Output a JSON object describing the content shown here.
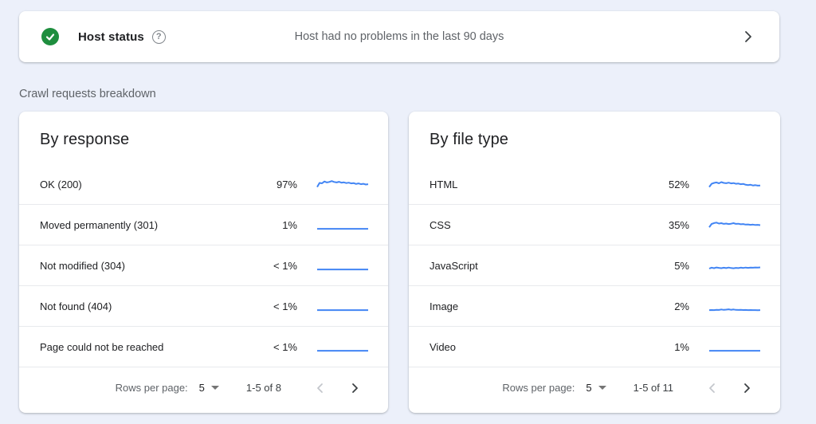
{
  "host_status": {
    "label": "Host status",
    "message": "Host had no problems in the last 90 days"
  },
  "section_title": "Crawl requests breakdown",
  "cards": [
    {
      "title": "By response",
      "rows": [
        {
          "label": "OK (200)",
          "percent": "97%",
          "spark": [
            2.5,
            7,
            6.5,
            8.5,
            7.5,
            8,
            9,
            8,
            7.5,
            8.2,
            7.2,
            7.6,
            6.8,
            7.2,
            6.4,
            6.8,
            5.8,
            6.4,
            5.6,
            6,
            5.2,
            5.6
          ]
        },
        {
          "label": "Moved permanently (301)",
          "percent": "1%",
          "spark": [
            1.2,
            1.2,
            1.2,
            1.2,
            1.2,
            1.2,
            1.2,
            1.2,
            1.2,
            1.2,
            1.2,
            1.2,
            1.2,
            1.2,
            1.2,
            1.2,
            1.2,
            1.2,
            1.2,
            1.2,
            1.2,
            1.2
          ]
        },
        {
          "label": "Not modified (304)",
          "percent": "< 1%",
          "spark": [
            1.2,
            1.2,
            1.2,
            1.2,
            1.2,
            1.2,
            1.2,
            1.2,
            1.2,
            1.2,
            1.2,
            1.2,
            1.2,
            1.2,
            1.2,
            1.2,
            1.2,
            1.2,
            1.2,
            1.2,
            1.2,
            1.2
          ]
        },
        {
          "label": "Not found (404)",
          "percent": "< 1%",
          "spark": [
            1.2,
            1.2,
            1.2,
            1.2,
            1.2,
            1.2,
            1.2,
            1.2,
            1.2,
            1.2,
            1.2,
            1.2,
            1.2,
            1.2,
            1.2,
            1.2,
            1.2,
            1.2,
            1.2,
            1.2,
            1.2,
            1.2
          ]
        },
        {
          "label": "Page could not be reached",
          "percent": "< 1%",
          "spark": [
            1.2,
            1.2,
            1.2,
            1.2,
            1.2,
            1.2,
            1.2,
            1.2,
            1.2,
            1.2,
            1.2,
            1.2,
            1.2,
            1.2,
            1.2,
            1.2,
            1.2,
            1.2,
            1.2,
            1.2,
            1.2,
            1.2
          ]
        }
      ],
      "footer": {
        "rows_per_page_label": "Rows per page:",
        "rows_per_page_value": "5",
        "range": "1-5 of 8"
      }
    },
    {
      "title": "By file type",
      "rows": [
        {
          "label": "HTML",
          "percent": "52%",
          "spark": [
            2.5,
            6,
            7,
            7.5,
            6.5,
            7.8,
            7,
            6.6,
            7.2,
            6.4,
            6.8,
            6,
            6.3,
            5.6,
            5.9,
            5,
            4.6,
            5,
            4.2,
            4.5,
            4,
            4.2
          ]
        },
        {
          "label": "CSS",
          "percent": "35%",
          "spark": [
            3,
            6.5,
            7.5,
            8,
            7,
            7.4,
            6.6,
            7,
            6.4,
            6.8,
            7.4,
            6.6,
            6.8,
            6.2,
            6.4,
            5.8,
            6,
            5.6,
            5.8,
            5.4,
            5.6,
            5.2
          ]
        },
        {
          "label": "JavaScript",
          "percent": "5%",
          "spark": [
            2.2,
            3.2,
            2.6,
            3.4,
            3,
            2.6,
            3.1,
            2.7,
            3.3,
            2.8,
            2.5,
            3,
            2.7,
            3.2,
            2.9,
            3.3,
            3,
            3.3,
            3.1,
            3.4,
            3.2,
            3.5
          ]
        },
        {
          "label": "Image",
          "percent": "2%",
          "spark": [
            1.2,
            1.3,
            1.2,
            1.6,
            1.4,
            1.9,
            1.5,
            1.7,
            2.1,
            1.6,
            1.9,
            1.5,
            1.4,
            1.6,
            1.3,
            1.4,
            1.2,
            1.3,
            1.2,
            1.2,
            1.1,
            1.2
          ]
        },
        {
          "label": "Video",
          "percent": "1%",
          "spark": [
            1.2,
            1.2,
            1.2,
            1.2,
            1.2,
            1.2,
            1.2,
            1.2,
            1.2,
            1.2,
            1.2,
            1.2,
            1.2,
            1.2,
            1.2,
            1.2,
            1.2,
            1.2,
            1.2,
            1.2,
            1.2,
            1.2
          ]
        }
      ],
      "footer": {
        "rows_per_page_label": "Rows per page:",
        "rows_per_page_value": "5",
        "range": "1-5 of 11"
      }
    }
  ],
  "icons": {
    "help_glyph": "?"
  },
  "colors": {
    "accent_blue": "#4285f4",
    "status_green": "#1e8e3e",
    "text_primary": "#202124",
    "text_secondary": "#5f6368",
    "divider": "#e8eaed",
    "background": "#ecf0fa"
  }
}
